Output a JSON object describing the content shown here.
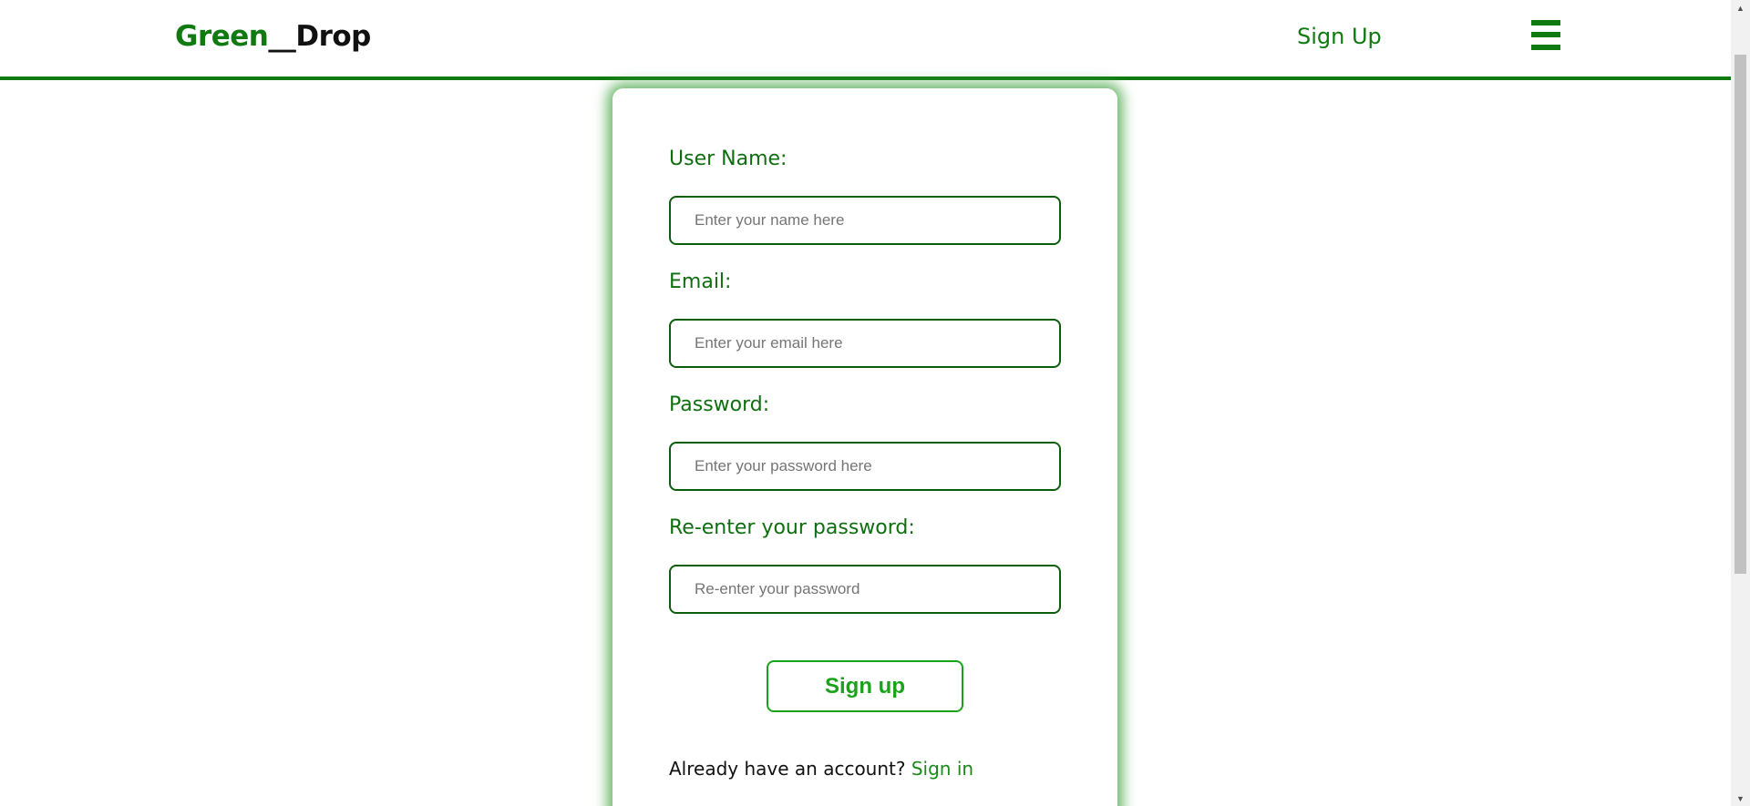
{
  "header": {
    "logo_part1": "Green",
    "logo_part2": "__Drop",
    "nav_signup_label": "Sign Up",
    "menu_icon": "hamburger-menu-icon"
  },
  "form": {
    "fields": [
      {
        "label": "User Name:",
        "placeholder": "Enter your name here",
        "value": ""
      },
      {
        "label": "Email:",
        "placeholder": "Enter your email here",
        "value": ""
      },
      {
        "label": "Password:",
        "placeholder": "Enter your password here",
        "value": ""
      },
      {
        "label": "Re-enter your password:",
        "placeholder": "Re-enter your password",
        "value": ""
      }
    ],
    "submit_label": "Sign up",
    "footer_text": "Already have an account?",
    "footer_link": "Sign in"
  },
  "colors": {
    "brand_green": "#0f7a0f",
    "button_green": "#1aa31a",
    "label_green": "#0f6e0f"
  }
}
